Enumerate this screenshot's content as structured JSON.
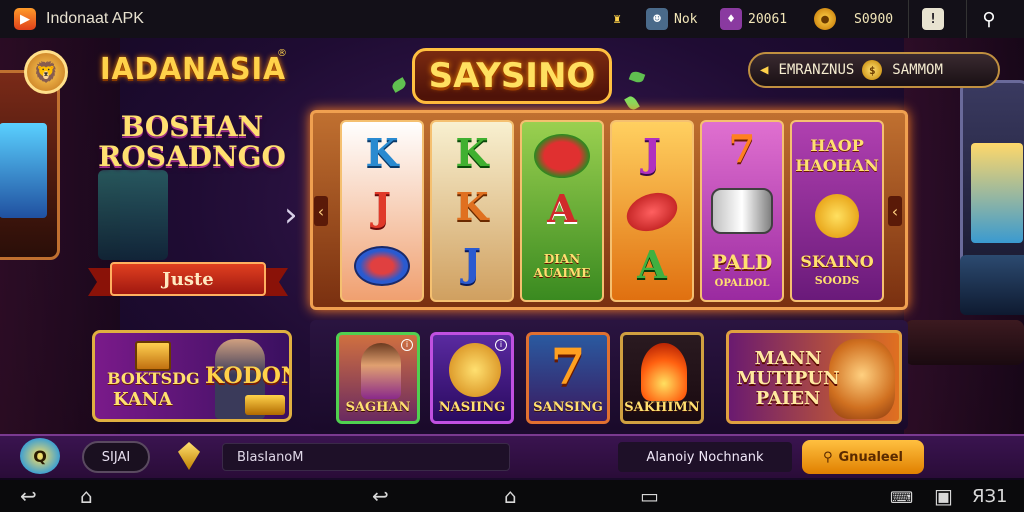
{
  "status_bar": {
    "app_title": "Indonaat APK",
    "player_name": "Nok",
    "stat_one": "20061",
    "stat_two": "S0900",
    "icons": [
      "app-logo-icon",
      "trophy-icon",
      "avatar-icon",
      "card-icon",
      "coin-icon",
      "notification-icon",
      "search-icon"
    ]
  },
  "brand": {
    "title": "IADANASIA",
    "reg_mark": "®"
  },
  "promo": {
    "title_line1": "BOSHAN",
    "title_line2": "ROSADNGO",
    "ribbon_label": "Juste"
  },
  "promo_card": {
    "line1": "BOKTSDG",
    "line2": "KODON",
    "line3": "KANA"
  },
  "slot": {
    "title": "SAYSINO",
    "reels": [
      {
        "symbols": [
          "K",
          "J",
          "bowl"
        ],
        "bg_top": "#ffffff",
        "bg_bottom": "#f0a070"
      },
      {
        "symbols": [
          "K",
          "K",
          "J"
        ],
        "bg_top": "#f8f0d0",
        "bg_bottom": "#d0a060"
      },
      {
        "symbols": [
          "watermelon",
          "A",
          "DIAN AUAIME"
        ],
        "bg_top": "#9ad050",
        "bg_bottom": "#3a8a20"
      },
      {
        "symbols": [
          "J",
          "red-gem",
          "A"
        ],
        "bg_top": "#ffd060",
        "bg_bottom": "#e07010"
      },
      {
        "symbols": [
          "7",
          "drum",
          "PALD",
          "OPALDOL"
        ],
        "bg_top": "#e070d0",
        "bg_bottom": "#9a2aa0"
      },
      {
        "symbols": [
          "HAOP",
          "HAOHAN",
          "orange",
          "SKAINO",
          "SOODS"
        ],
        "bg_top": "#b040b0",
        "bg_bottom": "#6a1a7a"
      }
    ]
  },
  "pill": {
    "left_text": "EMRANZNUS",
    "coin_symbol": "$",
    "right_text": "SAMMOM"
  },
  "game_tiles": [
    {
      "label": "SAGHAN",
      "border": "#50d050"
    },
    {
      "label": "NASIING",
      "border": "#c050e0"
    },
    {
      "label": "SANSING",
      "border": "#e07030"
    },
    {
      "label": "SAKHIMN",
      "border": "#d0a040"
    }
  ],
  "feature_card": {
    "line1": "MANN",
    "line2": "MUTIPUN",
    "line3": "PAIEN"
  },
  "bottom_bar": {
    "avatar_letter": "Q",
    "button_label": "SIJAI",
    "input_value": "BlasIanoM",
    "label_text": "Alanoiy Nochnank",
    "cta_label": "Gnualeel"
  },
  "nav_bar": {
    "right_text": "ЯЗ1",
    "icons": [
      "back-icon",
      "home-icon",
      "back-icon",
      "home-icon",
      "recents-icon",
      "keyboard-icon",
      "screen-icon"
    ]
  }
}
